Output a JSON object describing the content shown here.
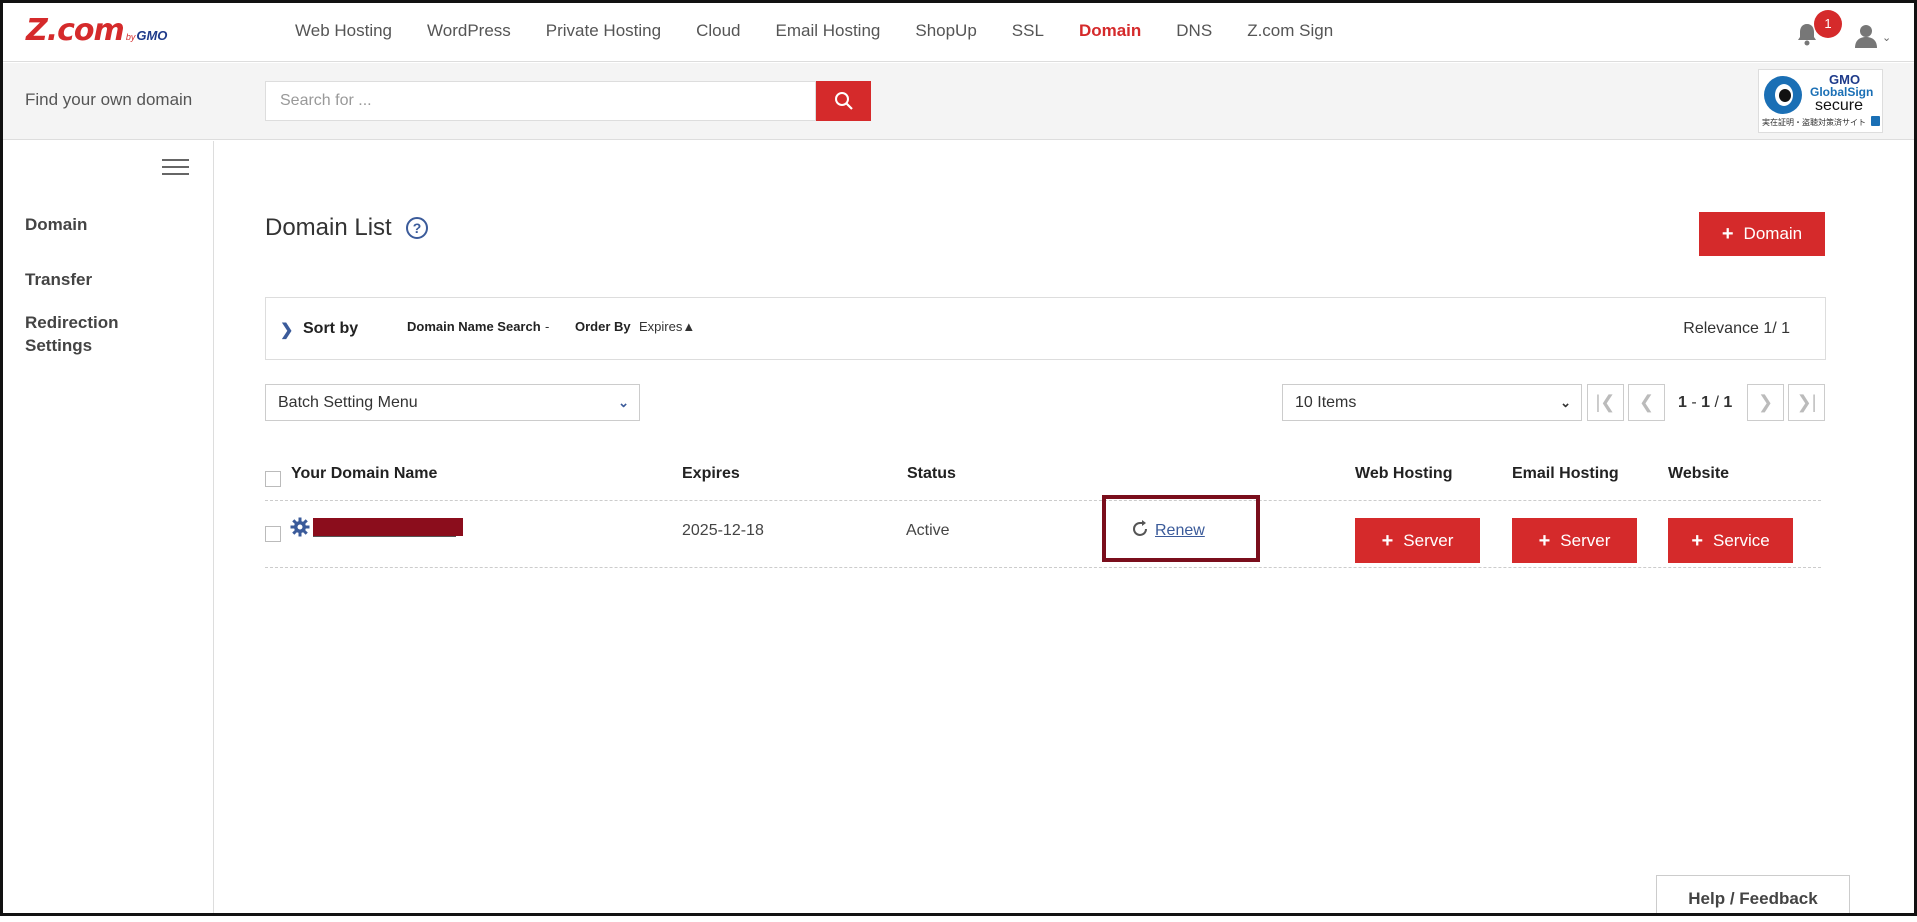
{
  "brand": {
    "logo_main": "Z.com",
    "logo_by": "by",
    "logo_gmo": "GMO"
  },
  "nav": {
    "items": [
      {
        "label": "Web Hosting",
        "active": false
      },
      {
        "label": "WordPress",
        "active": false
      },
      {
        "label": "Private Hosting",
        "active": false
      },
      {
        "label": "Cloud",
        "active": false
      },
      {
        "label": "Email Hosting",
        "active": false
      },
      {
        "label": "ShopUp",
        "active": false
      },
      {
        "label": "SSL",
        "active": false
      },
      {
        "label": "Domain",
        "active": true
      },
      {
        "label": "DNS",
        "active": false
      },
      {
        "label": "Z.com Sign",
        "active": false
      }
    ],
    "notification_count": "1"
  },
  "search": {
    "label": "Find your own domain",
    "placeholder": "Search for ..."
  },
  "globalsign": {
    "gmo": "GMO",
    "name": "GlobalSign",
    "secure": "secure",
    "jp_text": "実在証明・盗聴対策済サイト"
  },
  "sidebar": {
    "items": [
      {
        "label": "Domain"
      },
      {
        "label": "Transfer"
      },
      {
        "label": "Redirection Settings"
      }
    ]
  },
  "main": {
    "title": "Domain List",
    "help_symbol": "?",
    "add_domain_label": "Domain",
    "sort": {
      "label": "Sort by",
      "domain_name_search_label": "Domain Name Search",
      "domain_name_search_value": "-",
      "order_by_label": "Order By",
      "order_by_value": "Expires▲",
      "relevance": "Relevance 1/ 1"
    },
    "batch_menu": "Batch Setting Menu",
    "items_per_page": "10 Items",
    "pagination": {
      "first": "|❮",
      "prev": "❮",
      "range_start": "1",
      "range_sep": " - ",
      "range_end": "1",
      "range_of": " / ",
      "total": "1",
      "next": "❯",
      "last": "❯|"
    },
    "table": {
      "headers": {
        "domain": "Your Domain Name",
        "expires": "Expires",
        "status": "Status",
        "web_hosting": "Web Hosting",
        "email_hosting": "Email Hosting",
        "website": "Website"
      },
      "rows": [
        {
          "expires": "2025-12-18",
          "status": "Active",
          "renew": "Renew",
          "web_hosting_btn": "Server",
          "email_hosting_btn": "Server",
          "website_btn": "Service"
        }
      ]
    }
  },
  "footer": {
    "help_feedback": "Help / Feedback"
  },
  "colors": {
    "brand_red": "#d52a2b",
    "link_blue": "#3b5b9a",
    "highlight_box": "#7a0e1c"
  }
}
